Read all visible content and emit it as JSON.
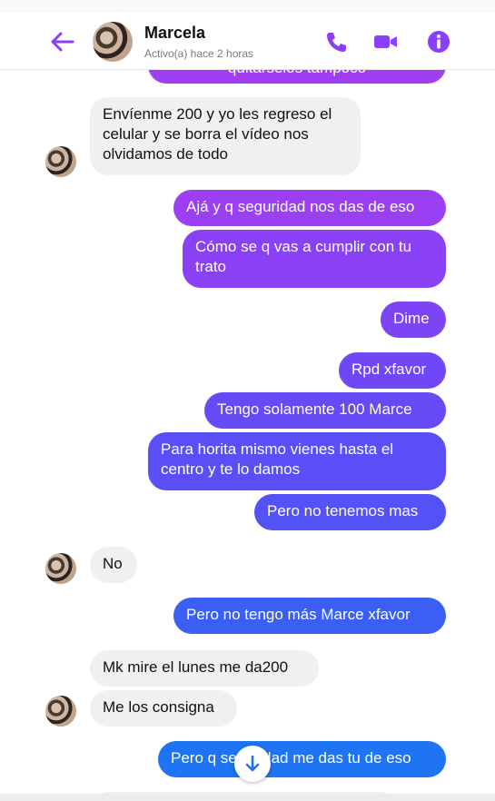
{
  "header": {
    "contact_name": "Marcela",
    "status": "Activo(a) hace 2 horas",
    "accent_color": "#8a3ffc"
  },
  "icons": {
    "back": "back-arrow-icon",
    "call": "phone-icon",
    "video": "video-camera-icon",
    "info": "info-icon",
    "scroll": "arrow-down-icon"
  },
  "messages": [
    {
      "id": "m0",
      "sender": "self",
      "text": "quitarselos tampoco",
      "color": "#a13ef0"
    },
    {
      "id": "m1",
      "sender": "contact",
      "text": "Envíenme 200 y yo les regreso el\ncelular y se borra el vídeo nos\nolvidamos de todo"
    },
    {
      "id": "m2",
      "sender": "self",
      "text": "Ajá y q seguridad nos das de eso",
      "color": "#9a3ff2"
    },
    {
      "id": "m3",
      "sender": "self",
      "text": "Cómo se q vas a cumplir con tu\ntrato",
      "color": "#8a40f4"
    },
    {
      "id": "m4",
      "sender": "self",
      "text": "Dime",
      "color": "#7c44f5"
    },
    {
      "id": "m5",
      "sender": "self",
      "text": "Rpd xfavor",
      "color": "#6f47f6"
    },
    {
      "id": "m6",
      "sender": "self",
      "text": "Tengo solamente 100 Marce",
      "color": "#654bf6"
    },
    {
      "id": "m7",
      "sender": "self",
      "text": "Para horita mismo vienes hasta el\ncentro y te lo damos",
      "color": "#5a4ff6"
    },
    {
      "id": "m8",
      "sender": "self",
      "text": "Pero no tenemos mas",
      "color": "#5252f6"
    },
    {
      "id": "m9",
      "sender": "contact",
      "text": "No"
    },
    {
      "id": "m10",
      "sender": "self",
      "text": "Pero no tengo más Marce xfavor",
      "color": "#3b5ff5"
    },
    {
      "id": "m11",
      "sender": "contact",
      "text": "Mk mire el lunes me da200"
    },
    {
      "id": "m12",
      "sender": "contact",
      "text": "Me los consigna"
    },
    {
      "id": "m13",
      "sender": "self",
      "text": "Pero q seguridad me das tu de eso",
      "color": "#1e74f2"
    }
  ]
}
